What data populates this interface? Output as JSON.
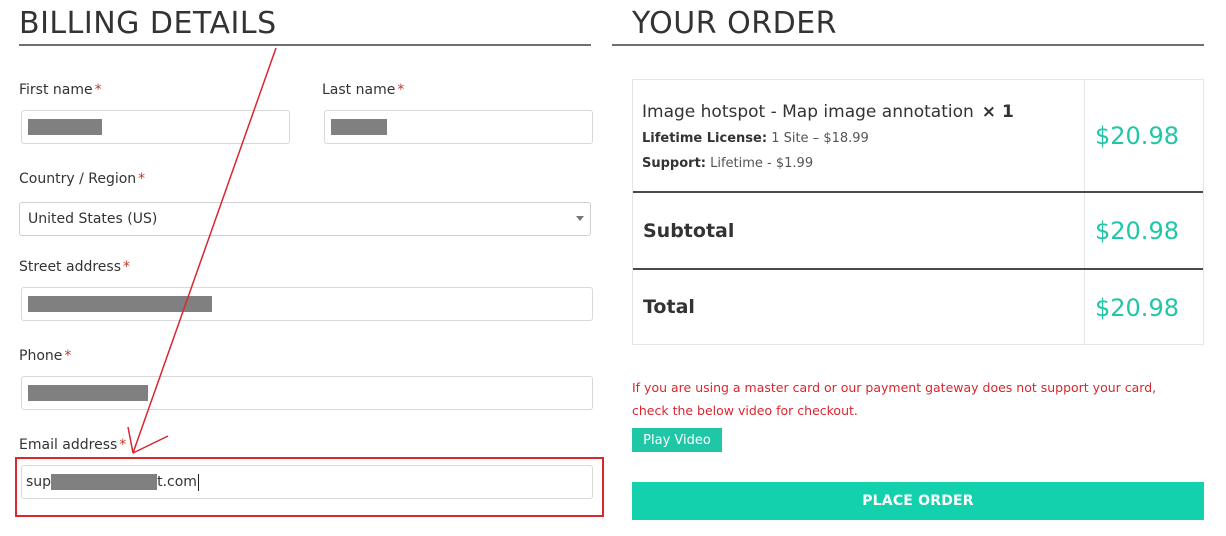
{
  "billing": {
    "title": "BILLING DETAILS",
    "required_mark": "*",
    "first_name_label": "First name",
    "last_name_label": "Last name",
    "country_label": "Country / Region",
    "country_value": "United States (US)",
    "street_label": "Street address",
    "phone_label": "Phone",
    "email_label": "Email address",
    "email_value_prefix": "sup",
    "email_value_suffix": "t.com"
  },
  "order": {
    "title": "YOUR ORDER",
    "product_name": "Image hotspot - Map image annotation",
    "product_qty": "× 1",
    "license_key": "Lifetime License:",
    "license_value": "1 Site – $18.99",
    "support_key": "Support:",
    "support_value": "Lifetime - $1.99",
    "product_price": "$20.98",
    "subtotal_label": "Subtotal",
    "subtotal_value": "$20.98",
    "total_label": "Total",
    "total_value": "$20.98"
  },
  "notice": {
    "text": "If you are using a master card or our payment gateway does not support your card, check the below video for checkout."
  },
  "buttons": {
    "play_video": "Play Video",
    "place_order": "PLACE ORDER"
  },
  "colors": {
    "accent": "#14d1ad",
    "price": "#1fc7a7",
    "alert": "#d9262f"
  }
}
